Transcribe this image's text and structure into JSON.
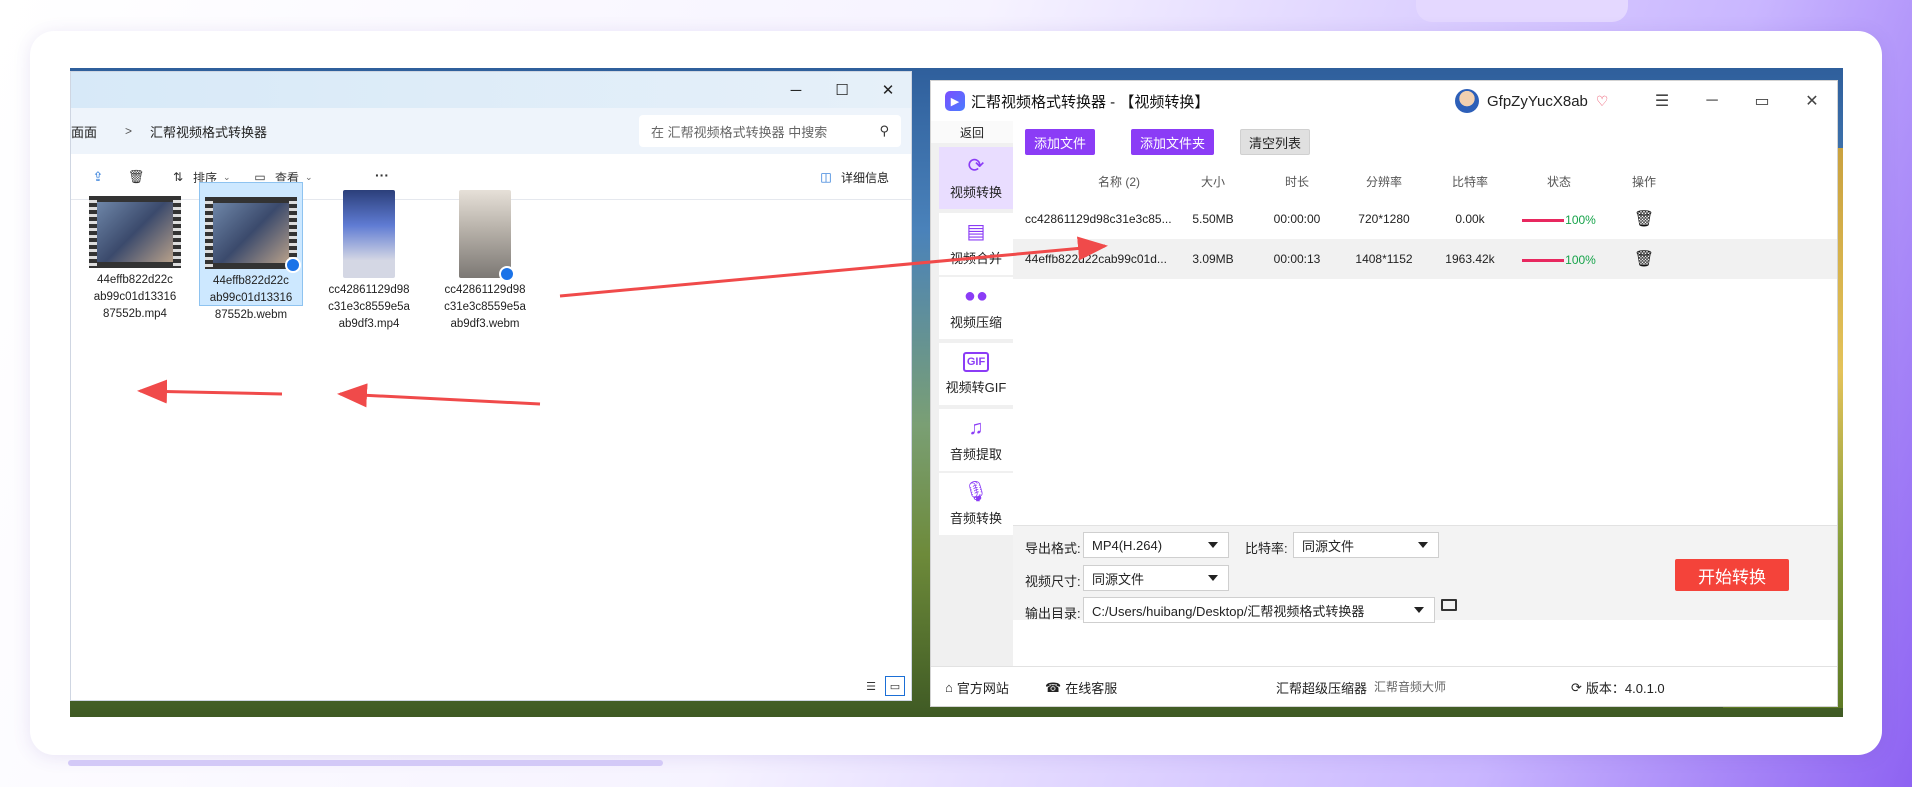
{
  "explorer": {
    "breadcrumb": [
      {
        "label": "面面"
      },
      {
        "label": "汇帮视频格式转换器"
      }
    ],
    "search_placeholder": "在 汇帮视频格式转换器 中搜索",
    "toolbar": {
      "sort": "排序",
      "view": "查看",
      "more": "···",
      "details": "详细信息"
    },
    "controls": {
      "minimize": "─",
      "maximize": "☐",
      "close": "✕"
    },
    "files": [
      {
        "name": "44effb822d22cab99c01d1331687552b.mp4",
        "lines": [
          "44effb822d22c",
          "ab99c01d13316",
          "87552b.mp4"
        ],
        "kind": "video",
        "selected": false
      },
      {
        "name": "44effb822d22cab99c01d1331687552b.webm",
        "lines": [
          "44effb822d22c",
          "ab99c01d13316",
          "87552b.webm"
        ],
        "kind": "video",
        "selected": true
      },
      {
        "name": "cc42861129d98c31e3c8559e5aab9df3.mp4",
        "lines": [
          "cc42861129d98",
          "c31e3c8559e5a",
          "ab9df3.mp4"
        ],
        "kind": "portrait",
        "selected": false
      },
      {
        "name": "cc42861129d98c31e3c8559e5aab9df3.webm",
        "lines": [
          "cc42861129d98",
          "c31e3c8559e5a",
          "ab9df3.webm"
        ],
        "kind": "portrait-light",
        "selected": false
      }
    ]
  },
  "app": {
    "title": "汇帮视频格式转换器 - 【视频转换】",
    "username": "GfpZyYucX8ab",
    "controls": {
      "menu": "☰",
      "minimize": "─",
      "maximize": "▭",
      "close": "✕"
    },
    "back_label": "返回",
    "nav": [
      {
        "label": "视频转换",
        "icon": "video-convert-icon",
        "active": true
      },
      {
        "label": "视频合并",
        "icon": "video-merge-icon",
        "active": false
      },
      {
        "label": "视频压缩",
        "icon": "video-compress-icon",
        "active": false
      },
      {
        "label": "视频转GIF",
        "icon": "gif-icon",
        "active": false
      },
      {
        "label": "音频提取",
        "icon": "music-note-icon",
        "active": false
      },
      {
        "label": "音频转换",
        "icon": "microphone-icon",
        "active": false
      }
    ],
    "buttons": {
      "add_file": "添加文件",
      "add_folder": "添加文件夹",
      "clear_list": "清空列表"
    },
    "table": {
      "headers": {
        "name": "名称 (2)",
        "size": "大小",
        "duration": "时长",
        "resolution": "分辨率",
        "bitrate": "比特率",
        "status": "状态",
        "action": "操作"
      },
      "rows": [
        {
          "name": "cc42861129d98c31e3c85...",
          "size": "5.50MB",
          "duration": "00:00:00",
          "resolution": "720*1280",
          "bitrate": "0.00k",
          "progress": "100%"
        },
        {
          "name": "44effb822d22cab99c01d...",
          "size": "3.09MB",
          "duration": "00:00:13",
          "resolution": "1408*1152",
          "bitrate": "1963.42k",
          "progress": "100%"
        }
      ]
    },
    "settings": {
      "format_label": "导出格式:",
      "format_value": "MP4(H.264)",
      "bitrate_label": "比特率:",
      "bitrate_value": "同源文件",
      "size_label": "视频尺寸:",
      "size_value": "同源文件",
      "output_label": "输出目录:",
      "output_value": "C:/Users/huibang/Desktop/汇帮视频格式转换器",
      "start_label": "开始转换"
    },
    "footer": {
      "website": "官方网站",
      "support": "在线客服",
      "compressor": "汇帮超级压缩器",
      "audio_master": "汇帮音频大师",
      "version": "版本：4.0.1.0"
    }
  },
  "colors": {
    "accent": "#8b3cf6",
    "start": "#f4433a",
    "progress_bar": "#e8285f",
    "progress_text": "#16a34a",
    "arrow": "#f04a4a"
  }
}
